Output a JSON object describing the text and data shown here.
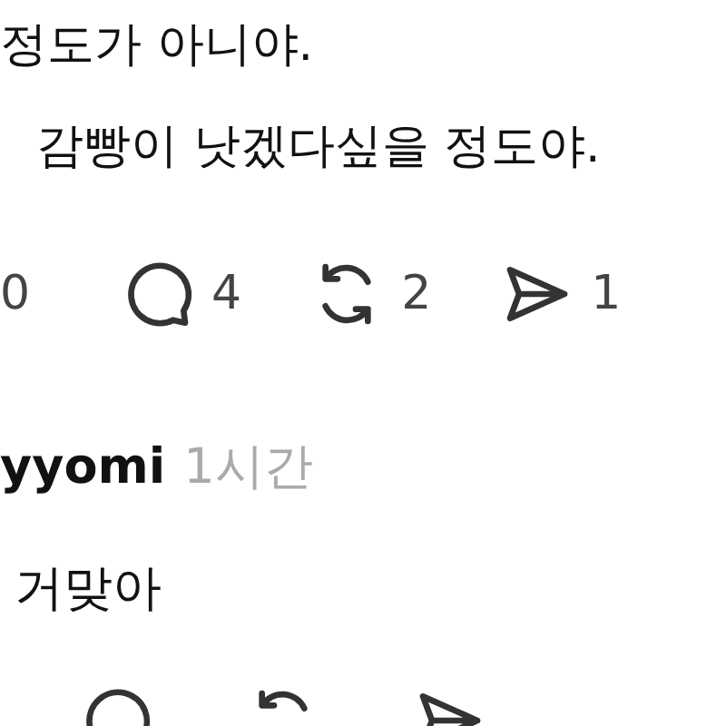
{
  "post": {
    "body_lines": [
      "정도가 아니야.",
      "감빵이 낫겠다싶을 정도야."
    ],
    "actions": [
      {
        "kind": "like",
        "count": "0"
      },
      {
        "kind": "comment",
        "count": "4"
      },
      {
        "kind": "repost",
        "count": "2"
      },
      {
        "kind": "share",
        "count": "1"
      }
    ]
  },
  "reply": {
    "username": "yyomi",
    "time": "1시간",
    "body": "거맞아",
    "actions": [
      {
        "kind": "comment"
      },
      {
        "kind": "repost"
      },
      {
        "kind": "share"
      }
    ]
  }
}
